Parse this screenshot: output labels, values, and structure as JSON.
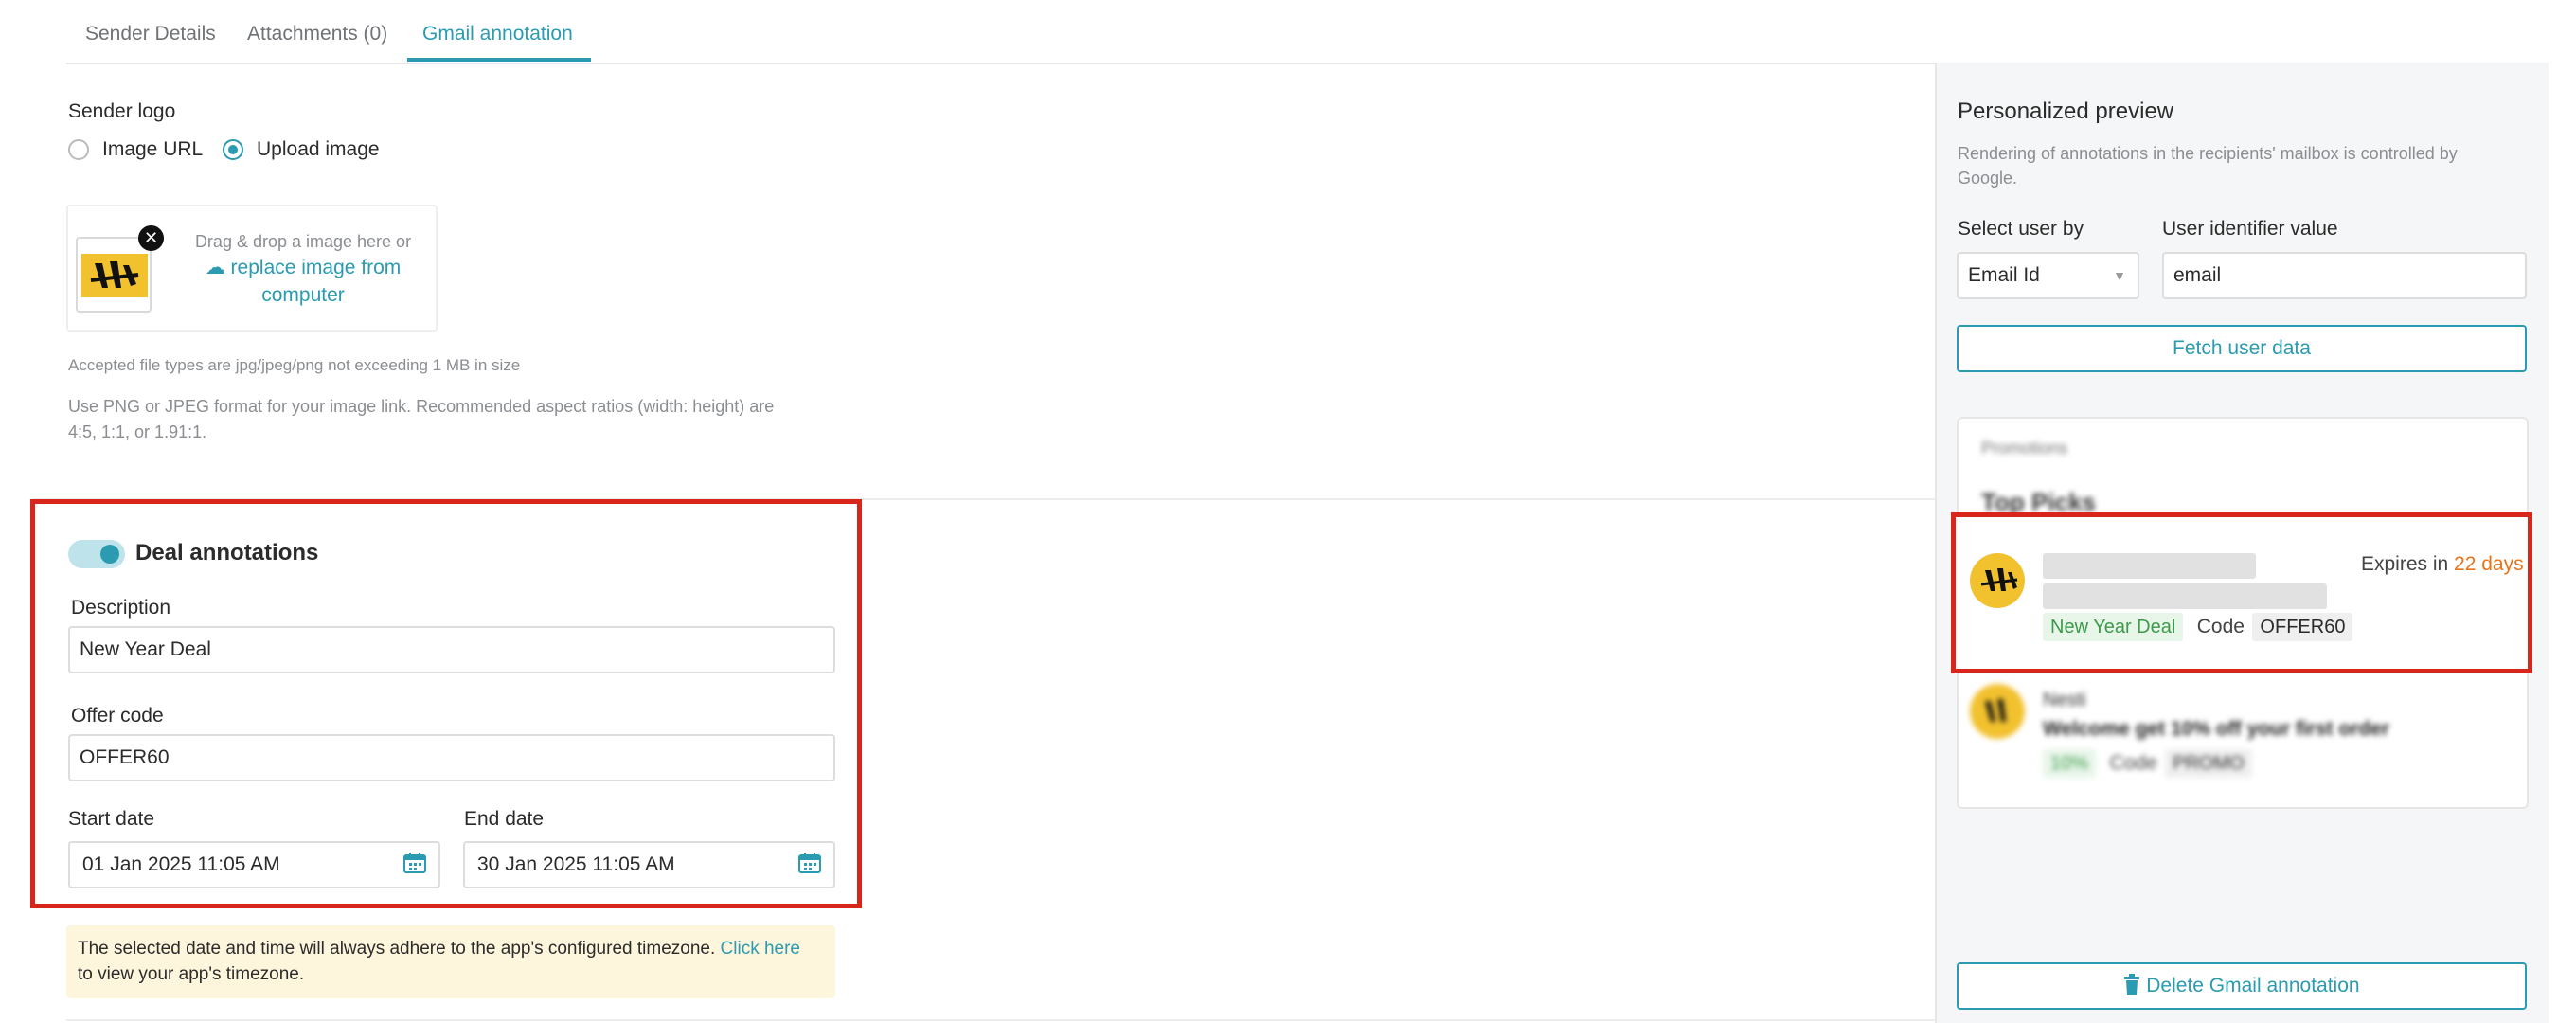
{
  "tabs": {
    "sender_details": "Sender Details",
    "attachments": "Attachments (0)",
    "gmail_annotation": "Gmail annotation"
  },
  "sender_logo": {
    "title": "Sender logo",
    "option_url": "Image URL",
    "option_upload": "Upload image",
    "selected": "Upload image",
    "drag_text": "Drag & drop a image here or",
    "replace_link": "replace image from computer",
    "accepted_note": "Accepted file types are jpg/jpeg/png not exceeding 1 MB in size",
    "format_note_line1": "Use PNG or JPEG format for your image link. Recommended aspect ratios (width: height) are",
    "format_note_line2": "4:5, 1:1, or 1.91:1."
  },
  "deal": {
    "toggle_label": "Deal annotations",
    "enabled": true,
    "description_label": "Description",
    "description_value": "New Year Deal",
    "offer_code_label": "Offer code",
    "offer_code_value": "OFFER60",
    "start_label": "Start date",
    "start_value": "01 Jan 2025 11:05 AM",
    "end_label": "End date",
    "end_value": "30 Jan 2025 11:05 AM",
    "notice_text": "The selected date and time will always adhere to the app's configured timezone.",
    "notice_link": "Click here",
    "notice_text2": "to view your app's timezone."
  },
  "preview": {
    "title": "Personalized preview",
    "subtitle_line1": "Rendering of annotations in the recipients' mailbox is controlled by",
    "subtitle_line2": "Google.",
    "select_user_label": "Select user by",
    "select_user_value": "Email Id",
    "identifier_label": "User identifier value",
    "identifier_value": "email",
    "fetch_button": "Fetch user data",
    "card": {
      "category": "Promotions",
      "heading": "Top Picks",
      "expires_prefix": "Expires in",
      "expires_value": "22 days",
      "deal_chip": "New Year Deal",
      "code_label": "Code",
      "code_value": "OFFER60",
      "item2_sender": "Nesti",
      "item2_subject": "Welcome get 10% off your first order",
      "item2_chip": "10%",
      "item2_code_label": "Code",
      "item2_code_value": "PROMO"
    },
    "delete_button": "Delete Gmail annotation"
  },
  "colors": {
    "accent": "#2a9bb0",
    "highlight_border": "#d9261c",
    "expires_orange": "#e8741a",
    "notice_bg": "#fdf6dd"
  }
}
